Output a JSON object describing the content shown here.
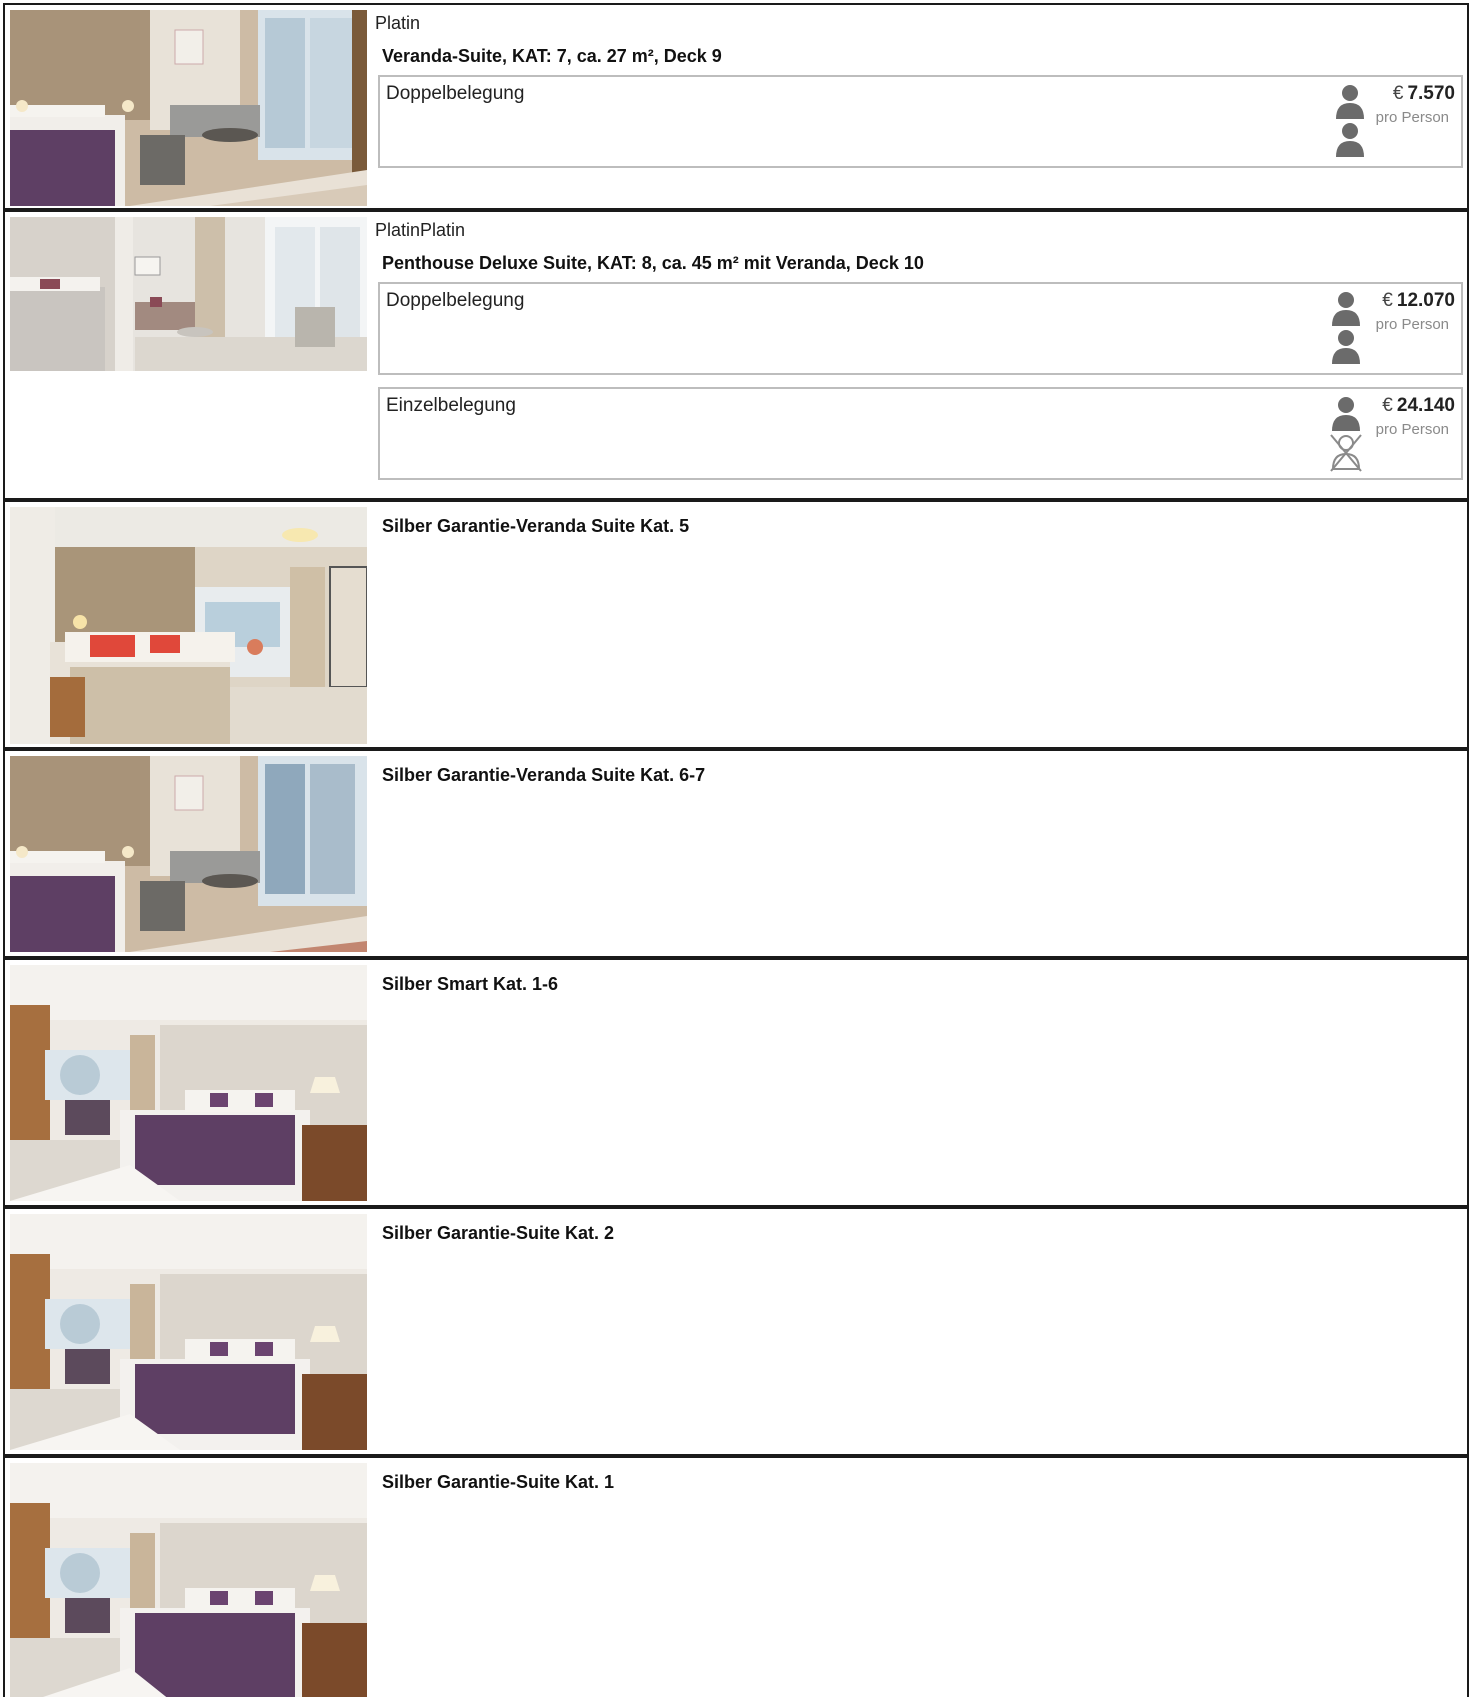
{
  "cabins": [
    {
      "tier": "Platin",
      "title": "Veranda-Suite, KAT: 7, ca. 27 m², Deck 9",
      "photo_icon": "veranda-suite-photo",
      "offers": [
        {
          "occupancy": "Doppelbelegung",
          "currency": "€",
          "amount": "7.570",
          "per": "pro Person",
          "persons_icon": "two-persons-icon"
        }
      ]
    },
    {
      "tier": "PlatinPlatin",
      "title": "Penthouse Deluxe Suite, KAT: 8, ca. 45 m² mit Veranda, Deck 10",
      "photo_icon": "penthouse-suite-photo",
      "offers": [
        {
          "occupancy": "Doppelbelegung",
          "currency": "€",
          "amount": "12.070",
          "per": "pro Person",
          "persons_icon": "two-persons-icon"
        },
        {
          "occupancy": "Einzelbelegung",
          "currency": "€",
          "amount": "24.140",
          "per": "pro Person",
          "persons_icon": "single-person-icon"
        }
      ]
    },
    {
      "tier": "",
      "title": "Silber Garantie-Veranda Suite Kat. 5",
      "photo_icon": "bright-suite-photo",
      "offers": []
    },
    {
      "tier": "",
      "title": "Silber Garantie-Veranda Suite Kat. 6-7",
      "photo_icon": "veranda-suite-photo",
      "offers": []
    },
    {
      "tier": "",
      "title": "Silber Smart Kat. 1-6",
      "photo_icon": "purple-bed-cabin-photo",
      "offers": []
    },
    {
      "tier": "",
      "title": "Silber Garantie-Suite Kat. 2",
      "photo_icon": "purple-bed-cabin-photo",
      "offers": []
    },
    {
      "tier": "",
      "title": "Silber Garantie-Suite Kat. 1",
      "photo_icon": "purple-bed-cabin-photo",
      "offers": []
    }
  ],
  "colors": {
    "border": "#1a1a1a",
    "box_border": "#bdbdbd",
    "person_icon": "#6b6b6b",
    "muted_text": "#8a8a8a",
    "bedspread_purple": "#5e3f64"
  }
}
